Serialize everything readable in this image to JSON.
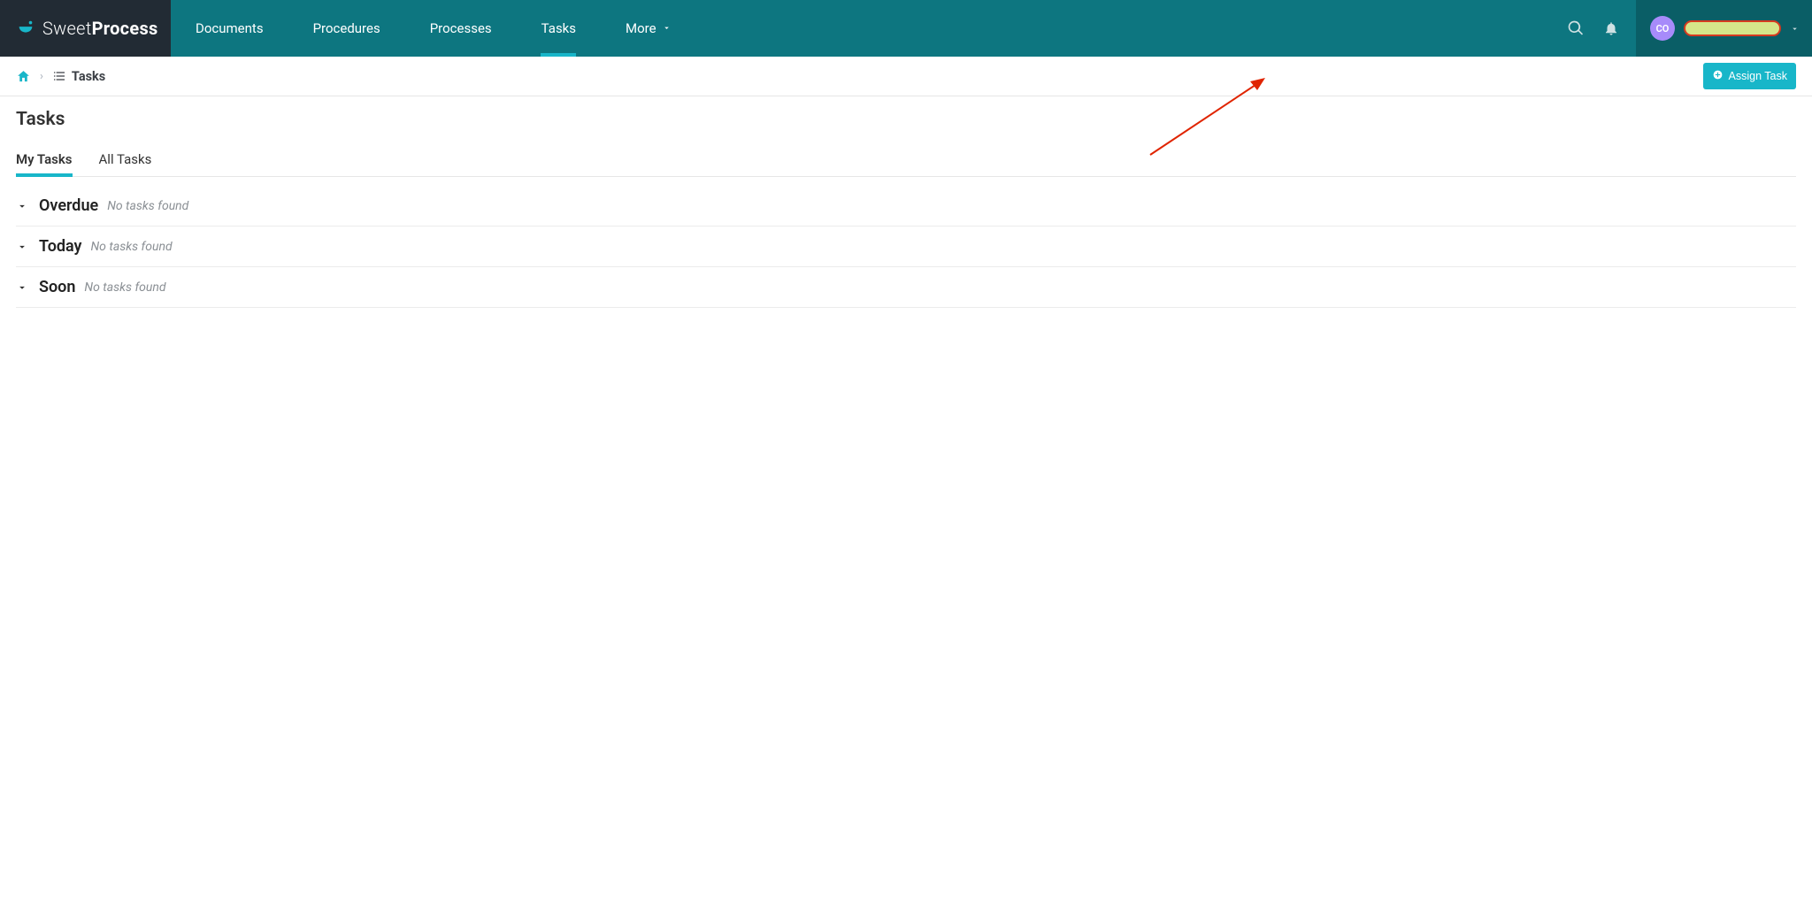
{
  "brand": {
    "name_light": "Sweet",
    "name_bold": "Process"
  },
  "nav": {
    "documents": "Documents",
    "procedures": "Procedures",
    "processes": "Processes",
    "tasks": "Tasks",
    "more": "More"
  },
  "user": {
    "initials": "CO"
  },
  "breadcrumb": {
    "current": "Tasks"
  },
  "actions": {
    "assign_task": "Assign Task"
  },
  "page": {
    "title": "Tasks"
  },
  "tabs": {
    "my_tasks": "My Tasks",
    "all_tasks": "All Tasks"
  },
  "sections": {
    "overdue": {
      "title": "Overdue",
      "empty": "No tasks found"
    },
    "today": {
      "title": "Today",
      "empty": "No tasks found"
    },
    "soon": {
      "title": "Soon",
      "empty": "No tasks found"
    }
  }
}
